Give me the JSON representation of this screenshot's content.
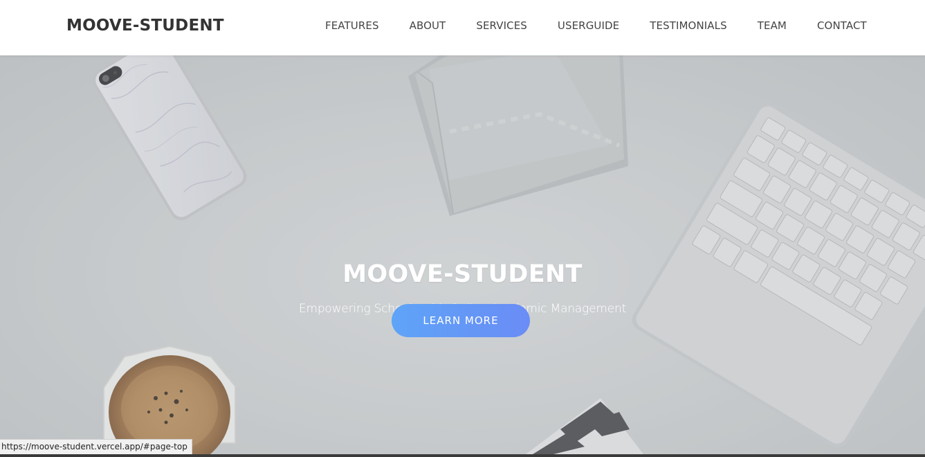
{
  "brand": "MOOVE-STUDENT",
  "nav": [
    {
      "label": "FEATURES"
    },
    {
      "label": "ABOUT"
    },
    {
      "label": "SERVICES"
    },
    {
      "label": "USERGUIDE"
    },
    {
      "label": "TESTIMONIALS"
    },
    {
      "label": "TEAM"
    },
    {
      "label": "CONTACT"
    }
  ],
  "hero": {
    "title": "MOOVE-STUDENT",
    "subtitle": "Empowering Schools with Online Academic Management",
    "button_label": "LEARN MORE"
  },
  "status_bar": {
    "url": "https://moove-student.vercel.app/#page-top"
  },
  "colors": {
    "button_gradient_start": "#5ea4f7",
    "button_gradient_end": "#6a8cf6",
    "nav_background": "#ffffff",
    "brand_text": "#333333"
  }
}
